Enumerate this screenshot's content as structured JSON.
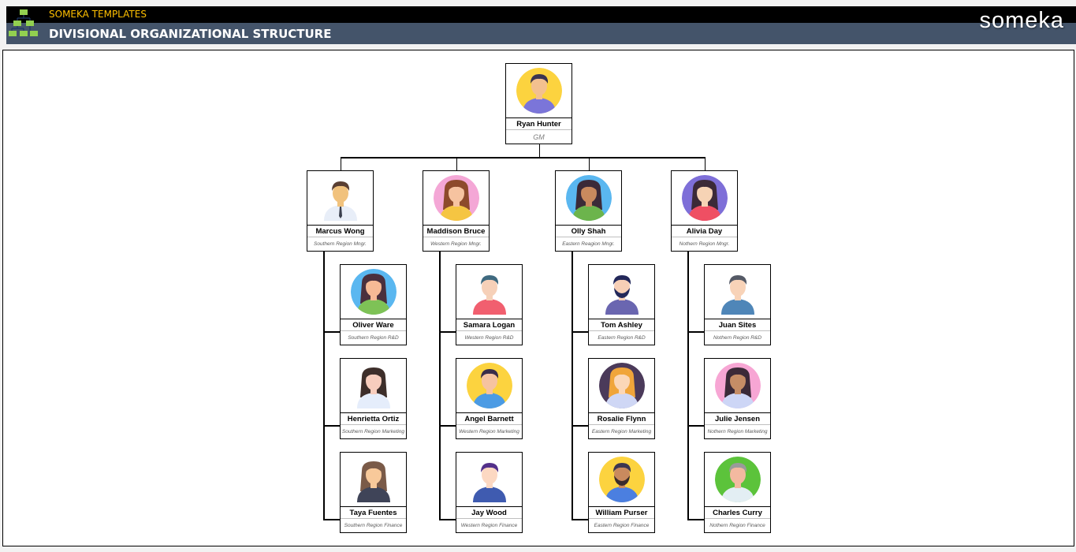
{
  "header": {
    "brand_label": "SOMEKA TEMPLATES",
    "title": "DIVISIONAL ORGANIZATIONAL STRUCTURE",
    "logo_text": "someka",
    "colors": {
      "top_bar": "#000000",
      "title_bar": "#44546a",
      "brand_label": "#ffc000",
      "title": "#ffffff",
      "logo_icon": "#92d050"
    }
  },
  "org": {
    "root": {
      "name": "Ryan Hunter",
      "role": "GM",
      "avatar": "man-purple-shirt-yellow-bg"
    },
    "divisions": [
      {
        "manager": {
          "name": "Marcus Wong",
          "role": "Southern Region Mngr.",
          "avatar": "man-shirt-tie"
        },
        "members": [
          {
            "name": "Oliver Ware",
            "role": "Southern Region R&D",
            "avatar": "woman-green-top-blue-bg"
          },
          {
            "name": "Henrietta Ortiz",
            "role": "Southern Region Marketing",
            "avatar": "woman-bob-hair-white-uniform"
          },
          {
            "name": "Taya Fuentes",
            "role": "Southern Region Finance",
            "avatar": "woman-dark-blazer"
          }
        ]
      },
      {
        "manager": {
          "name": "Maddison Bruce",
          "role": "Western Region Mngr.",
          "avatar": "woman-yellow-jacket-pink-bg"
        },
        "members": [
          {
            "name": "Samara Logan",
            "role": "Western Region R&D",
            "avatar": "man-red-shirt"
          },
          {
            "name": "Angel Barnett",
            "role": "Western Region Marketing",
            "avatar": "woman-ponytail-yellow-bg"
          },
          {
            "name": "Jay Wood",
            "role": "Western Region Finance",
            "avatar": "man-purple-hair-blue-shirt"
          }
        ]
      },
      {
        "manager": {
          "name": "Olly Shah",
          "role": "Eastern Reagion Mngr.",
          "avatar": "woman-green-hoodie-blue-bg"
        },
        "members": [
          {
            "name": "Tom Ashley",
            "role": "Eastern Region R&D",
            "avatar": "man-beard-glasses"
          },
          {
            "name": "Rosalie Flynn",
            "role": "Eastern Region Marketing",
            "avatar": "woman-blonde-dark-bg"
          },
          {
            "name": "William Purser",
            "role": "Eastern Region Finance",
            "avatar": "man-beard-blue-jacket-yellow-bg"
          }
        ]
      },
      {
        "manager": {
          "name": "Alivia Day",
          "role": "Nothern Region Mngr.",
          "avatar": "woman-red-hoodie-purple-bg"
        },
        "members": [
          {
            "name": "Juan Sites",
            "role": "Nothern Region R&D",
            "avatar": "man-blue-shirt"
          },
          {
            "name": "Julie Jensen",
            "role": "Nothern Region Marketing",
            "avatar": "woman-curly-hair-pink-bg"
          },
          {
            "name": "Charles Curry",
            "role": "Nothern Region Finance",
            "avatar": "old-man-glasses-green-bg"
          }
        ]
      }
    ]
  }
}
